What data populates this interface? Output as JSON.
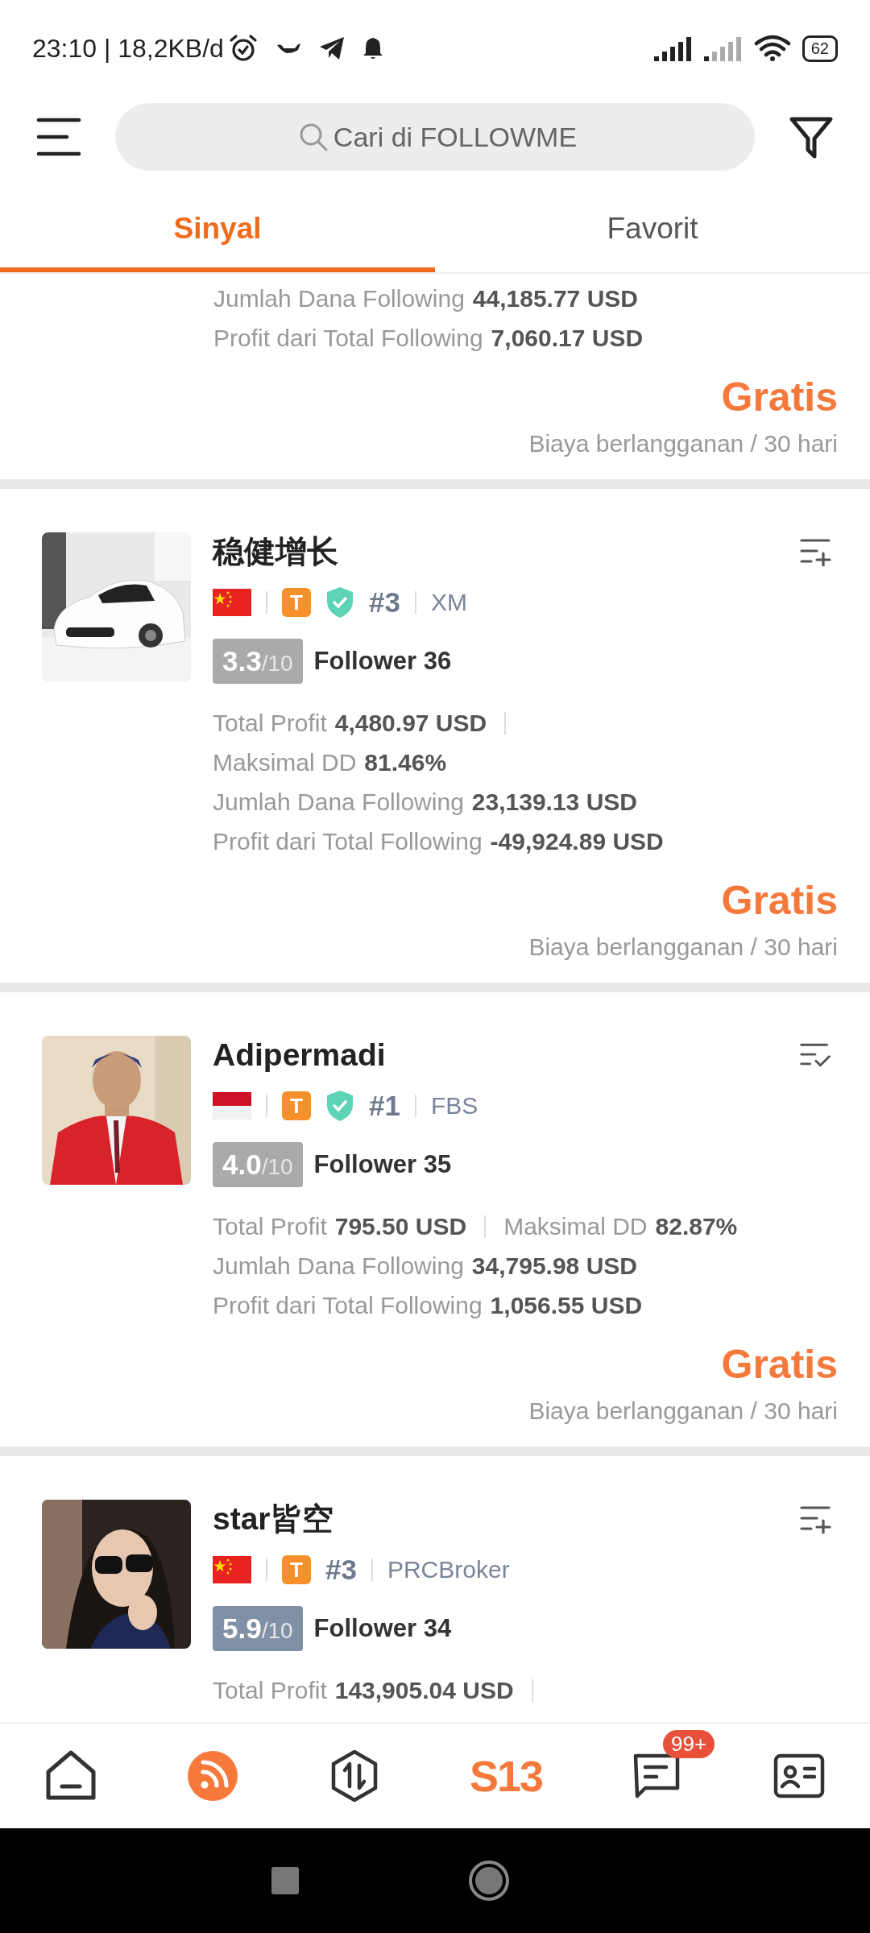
{
  "status_bar": {
    "time": "23:10 | 18,2KB/d",
    "battery": "62"
  },
  "search": {
    "placeholder": "Cari di FOLLOWME"
  },
  "tabs": [
    {
      "label": "Sinyal",
      "selected": true
    },
    {
      "label": "Favorit",
      "selected": false
    }
  ],
  "cards": [
    {
      "kind": "partial",
      "stats": [
        {
          "items": [
            {
              "label": "Jumlah Dana Following",
              "value": "44,185.77 USD"
            }
          ]
        },
        {
          "items": [
            {
              "label": "Profit dari Total Following",
              "value": "7,060.17 USD"
            }
          ]
        }
      ],
      "price": "Gratis",
      "price_note": "Biaya berlangganan / 30 hari"
    },
    {
      "kind": "full",
      "avatar": {
        "kind": "picture"
      },
      "name": "稳健增长",
      "action": {
        "kind": "add"
      },
      "flag": {
        "kind": "china"
      },
      "tier": "T",
      "verified": true,
      "rank": "#3",
      "broker": "XM",
      "score": {
        "value": "3.3",
        "max": "/10",
        "color": "#aaaaaa"
      },
      "followers": "Follower 36",
      "stats": [
        {
          "items": [
            {
              "label": "Total Profit",
              "value": "4,480.97 USD"
            }
          ],
          "divider_after": true
        },
        {
          "items": [
            {
              "label": "Maksimal DD",
              "value": "81.46%"
            }
          ]
        },
        {
          "items": [
            {
              "label": "Jumlah Dana Following",
              "value": "23,139.13 USD"
            }
          ]
        },
        {
          "items": [
            {
              "label": "Profit dari Total Following",
              "value": "-49,924.89 USD"
            }
          ]
        }
      ],
      "price": "Gratis",
      "price_note": "Biaya berlangganan / 30 hari"
    },
    {
      "kind": "full",
      "avatar": {
        "kind": "picture"
      },
      "name": "Adipermadi",
      "action": {
        "kind": "added"
      },
      "flag": {
        "kind": "indonesia"
      },
      "tier": "T",
      "verified": true,
      "rank": "#1",
      "broker": "FBS",
      "score": {
        "value": "4.0",
        "max": "/10",
        "color": "#aaaaaa"
      },
      "followers": "Follower 35",
      "stats": [
        {
          "items": [
            {
              "label": "Total Profit",
              "value": "795.50 USD"
            },
            {
              "label": "Maksimal DD",
              "value": "82.87%"
            }
          ]
        },
        {
          "items": [
            {
              "label": "Jumlah Dana Following",
              "value": "34,795.98 USD"
            }
          ]
        },
        {
          "items": [
            {
              "label": "Profit dari Total Following",
              "value": "1,056.55 USD"
            }
          ]
        }
      ],
      "price": "Gratis",
      "price_note": "Biaya berlangganan / 30 hari"
    },
    {
      "kind": "full",
      "avatar": {
        "kind": "picture"
      },
      "name": "star皆空",
      "action": {
        "kind": "add"
      },
      "flag": {
        "kind": "china"
      },
      "tier": "T",
      "verified": false,
      "rank": "#3",
      "broker": "PRCBroker",
      "score": {
        "value": "5.9",
        "max": "/10",
        "color": "#8090a6"
      },
      "followers": "Follower 34",
      "stats": [
        {
          "items": [
            {
              "label": "Total Profit",
              "value": "143,905.04 USD"
            }
          ],
          "divider_after": true
        }
      ]
    }
  ],
  "nav": [
    {
      "kind": "home",
      "selected": false
    },
    {
      "kind": "feed",
      "selected": true
    },
    {
      "kind": "trade",
      "selected": false
    },
    {
      "kind": "logo",
      "label": "S13",
      "selected": false
    },
    {
      "kind": "messages",
      "badge": "99+",
      "selected": false
    },
    {
      "kind": "profile",
      "selected": false
    }
  ]
}
